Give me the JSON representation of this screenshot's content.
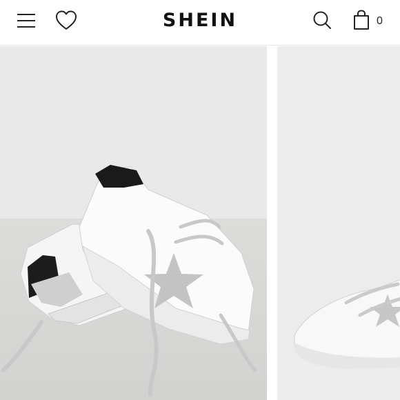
{
  "header": {
    "logo_text": "SHEIN",
    "menu_icon": "hamburger-menu-icon",
    "wishlist_icon": "heart-icon",
    "search_icon": "search-icon",
    "bag_icon": "shopping-bag-icon",
    "bag_count": "0"
  },
  "gallery": {
    "products": [
      {
        "image": "white-star-sneakers-pair-photo",
        "backdrop_color": "#e9e9e9",
        "floor_color": "#d9d9d7"
      },
      {
        "image": "white-star-sneaker-side-photo",
        "backdrop_color": "#ececec"
      }
    ]
  },
  "colors": {
    "header_background": "#ffffff",
    "logo": "#111111",
    "icon_stroke": "#222222"
  }
}
